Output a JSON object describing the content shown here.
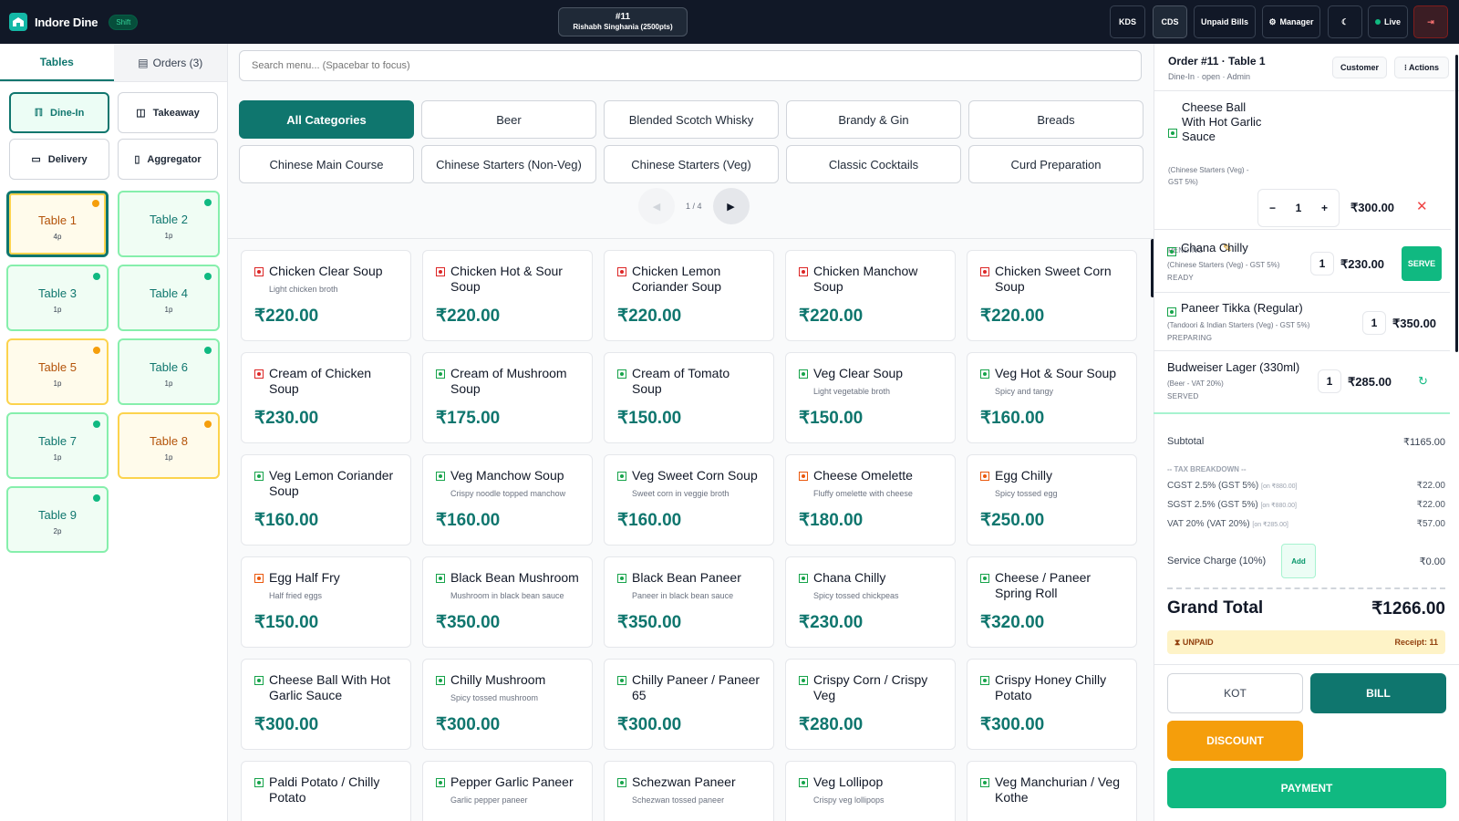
{
  "app": {
    "name": "Indore Dine",
    "shift_label": "Shift"
  },
  "current_order": {
    "number": "#11",
    "customer": "Rishabh Singhania (2500pts)"
  },
  "topbar": {
    "kds": "KDS",
    "cds": "CDS",
    "unpaid_bills": "Unpaid Bills",
    "manager": "Manager",
    "live": "Live"
  },
  "left_tabs": {
    "tables": "Tables",
    "orders": "Orders (3)"
  },
  "order_types": {
    "dine_in": "Dine-In",
    "takeaway": "Takeaway",
    "delivery": "Delivery",
    "aggregator": "Aggregator"
  },
  "tables": [
    {
      "name": "Table 1",
      "pax": "4p",
      "status": "busy"
    },
    {
      "name": "Table 2",
      "pax": "1p",
      "status": "free"
    },
    {
      "name": "Table 3",
      "pax": "1p",
      "status": "free"
    },
    {
      "name": "Table 4",
      "pax": "1p",
      "status": "free"
    },
    {
      "name": "Table 5",
      "pax": "1p",
      "status": "busy"
    },
    {
      "name": "Table 6",
      "pax": "1p",
      "status": "free"
    },
    {
      "name": "Table 7",
      "pax": "1p",
      "status": "free"
    },
    {
      "name": "Table 8",
      "pax": "1p",
      "status": "busy"
    },
    {
      "name": "Table 9",
      "pax": "2p",
      "status": "free"
    }
  ],
  "search": {
    "placeholder": "Search menu... (Spacebar to focus)"
  },
  "categories": [
    "All Categories",
    "Beer",
    "Blended Scotch Whisky",
    "Brandy & Gin",
    "Breads",
    "Chinese Main Course",
    "Chinese Starters (Non-Veg)",
    "Chinese Starters (Veg)",
    "Classic Cocktails",
    "Curd Preparation"
  ],
  "pager": {
    "info": "1 / 4"
  },
  "menu_items": [
    {
      "name": "Chicken Clear Soup",
      "desc": "Light chicken broth",
      "price": "₹220.00",
      "type": "nv"
    },
    {
      "name": "Chicken Hot & Sour Soup",
      "desc": "",
      "price": "₹220.00",
      "type": "nv"
    },
    {
      "name": "Chicken Lemon Coriander Soup",
      "desc": "",
      "price": "₹220.00",
      "type": "nv"
    },
    {
      "name": "Chicken Manchow Soup",
      "desc": "",
      "price": "₹220.00",
      "type": "nv"
    },
    {
      "name": "Chicken Sweet Corn Soup",
      "desc": "",
      "price": "₹220.00",
      "type": "nv"
    },
    {
      "name": "Cream of Chicken Soup",
      "desc": "",
      "price": "₹230.00",
      "type": "nv"
    },
    {
      "name": "Cream of Mushroom Soup",
      "desc": "",
      "price": "₹175.00",
      "type": "v"
    },
    {
      "name": "Cream of Tomato Soup",
      "desc": "",
      "price": "₹150.00",
      "type": "v"
    },
    {
      "name": "Veg Clear Soup",
      "desc": "Light vegetable broth",
      "price": "₹150.00",
      "type": "v"
    },
    {
      "name": "Veg Hot & Sour Soup",
      "desc": "Spicy and tangy",
      "price": "₹160.00",
      "type": "v"
    },
    {
      "name": "Veg Lemon Coriander Soup",
      "desc": "",
      "price": "₹160.00",
      "type": "v"
    },
    {
      "name": "Veg Manchow Soup",
      "desc": "Crispy noodle topped manchow",
      "price": "₹160.00",
      "type": "v"
    },
    {
      "name": "Veg Sweet Corn Soup",
      "desc": "Sweet corn in veggie broth",
      "price": "₹160.00",
      "type": "v"
    },
    {
      "name": "Cheese Omelette",
      "desc": "Fluffy omelette with cheese",
      "price": "₹180.00",
      "type": "eg"
    },
    {
      "name": "Egg Chilly",
      "desc": "Spicy tossed egg",
      "price": "₹250.00",
      "type": "eg"
    },
    {
      "name": "Egg Half Fry",
      "desc": "Half fried eggs",
      "price": "₹150.00",
      "type": "eg"
    },
    {
      "name": "Black Bean Mushroom",
      "desc": "Mushroom in black bean sauce",
      "price": "₹350.00",
      "type": "v"
    },
    {
      "name": "Black Bean Paneer",
      "desc": "Paneer in black bean sauce",
      "price": "₹350.00",
      "type": "v"
    },
    {
      "name": "Chana Chilly",
      "desc": "Spicy tossed chickpeas",
      "price": "₹230.00",
      "type": "v"
    },
    {
      "name": "Cheese / Paneer Spring Roll",
      "desc": "",
      "price": "₹320.00",
      "type": "v"
    },
    {
      "name": "Cheese Ball With Hot Garlic Sauce",
      "desc": "",
      "price": "₹300.00",
      "type": "v"
    },
    {
      "name": "Chilly Mushroom",
      "desc": "Spicy tossed mushroom",
      "price": "₹300.00",
      "type": "v"
    },
    {
      "name": "Chilly Paneer / Paneer 65",
      "desc": "",
      "price": "₹300.00",
      "type": "v"
    },
    {
      "name": "Crispy Corn / Crispy Veg",
      "desc": "",
      "price": "₹280.00",
      "type": "v"
    },
    {
      "name": "Crispy Honey Chilly Potato",
      "desc": "",
      "price": "₹300.00",
      "type": "v"
    },
    {
      "name": "Paldi Potato / Chilly Potato",
      "desc": "",
      "price": "",
      "type": "v"
    },
    {
      "name": "Pepper Garlic Paneer",
      "desc": "Garlic pepper paneer",
      "price": "",
      "type": "v"
    },
    {
      "name": "Schezwan Paneer",
      "desc": "Schezwan tossed paneer",
      "price": "",
      "type": "v"
    },
    {
      "name": "Veg Lollipop",
      "desc": "Crispy veg lollipops",
      "price": "",
      "type": "v"
    },
    {
      "name": "Veg Manchurian / Veg Kothe",
      "desc": "",
      "price": "",
      "type": "v"
    }
  ],
  "order_panel": {
    "title": "Order #11 · Table 1",
    "subtitle": "Dine-In · open · Admin",
    "customer_btn": "Customer",
    "actions_btn": "⁝ Actions",
    "items": [
      {
        "name": "Cheese Ball With Hot Garlic Sauce",
        "meta": "(Chinese Starters (Veg) - GST 5%)",
        "status": "PENDING",
        "qty": "1",
        "price": "₹300.00"
      },
      {
        "name": "Chana Chilly",
        "meta": "(Chinese Starters (Veg) - GST 5%)",
        "status": "READY",
        "qty": "1",
        "price": "₹230.00",
        "action": "SERVE"
      },
      {
        "name": "Paneer Tikka (Regular)",
        "meta": "(Tandoori & Indian Starters (Veg) - GST 5%)",
        "status": "PREPARING",
        "qty": "1",
        "price": "₹350.00"
      },
      {
        "name": "Budweiser Lager (330ml)",
        "meta": "(Beer - VAT 20%)",
        "status": "SERVED",
        "qty": "1",
        "price": "₹285.00"
      }
    ],
    "subtotal_label": "Subtotal",
    "subtotal": "₹1165.00",
    "tax_heading": "-- TAX BREAKDOWN --",
    "taxes": [
      {
        "label": "CGST 2.5% (GST 5%)",
        "on": "[on ₹880.00]",
        "amount": "₹22.00"
      },
      {
        "label": "SGST 2.5% (GST 5%)",
        "on": "[on ₹880.00]",
        "amount": "₹22.00"
      },
      {
        "label": "VAT 20% (VAT 20%)",
        "on": "[on ₹285.00]",
        "amount": "₹57.00"
      }
    ],
    "service_label": "Service Charge (10%)",
    "service_add": "Add",
    "service_amount": "₹0.00",
    "grand_label": "Grand Total",
    "grand_total": "₹1266.00",
    "payment_status": "UNPAID",
    "receipt": "Receipt: 11",
    "kot": "KOT",
    "bill": "BILL",
    "discount": "DISCOUNT",
    "payment": "PAYMENT"
  },
  "colors": {
    "primary": "#0f766e",
    "accent": "#10b981",
    "warning": "#f59e0b",
    "topbar": "#111827"
  }
}
